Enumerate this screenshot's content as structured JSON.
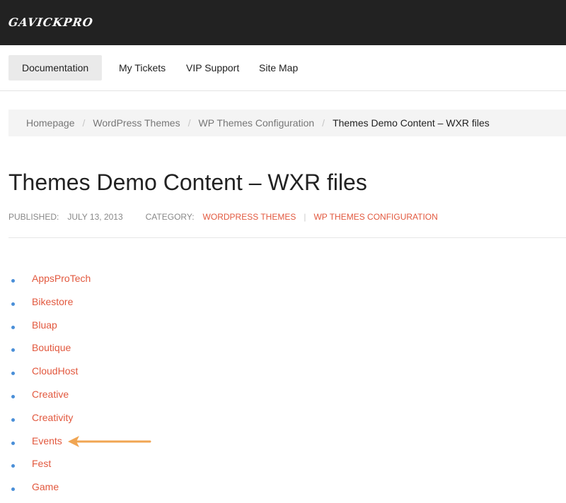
{
  "header": {
    "logo_text": "GAVICKPRO"
  },
  "nav": {
    "items": [
      {
        "label": "Documentation",
        "active": true
      },
      {
        "label": "My Tickets",
        "active": false
      },
      {
        "label": "VIP Support",
        "active": false
      },
      {
        "label": "Site Map",
        "active": false
      }
    ]
  },
  "breadcrumb": {
    "items": [
      "Homepage",
      "WordPress Themes",
      "WP Themes Configuration"
    ],
    "current": "Themes Demo Content – WXR files",
    "separator": "/"
  },
  "page": {
    "title": "Themes Demo Content – WXR files",
    "published_label": "PUBLISHED:",
    "published_date": "JULY 13, 2013",
    "category_label": "CATEGORY:",
    "categories": [
      "WORDPRESS THEMES",
      "WP THEMES CONFIGURATION"
    ],
    "category_separator": "|"
  },
  "themes": [
    "AppsProTech",
    "Bikestore",
    "Bluap",
    "Boutique",
    "CloudHost",
    "Creative",
    "Creativity",
    "Events",
    "Fest",
    "Game"
  ],
  "annotation": {
    "type": "arrow",
    "points_to": "Events",
    "color": "#f0a552"
  },
  "colors": {
    "link": "#e2583e",
    "bullet": "#4a8fd8",
    "topbar": "#222222",
    "nav_active_bg": "#eaeaea",
    "breadcrumb_bg": "#f4f4f4"
  }
}
